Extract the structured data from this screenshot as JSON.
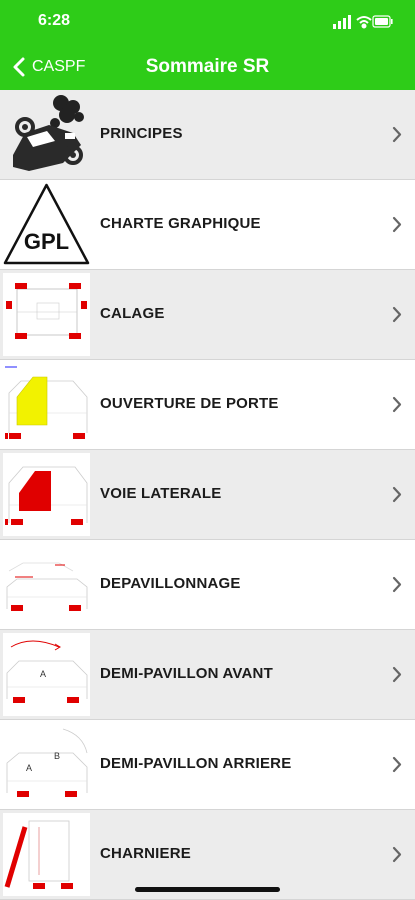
{
  "status": {
    "time": "6:28"
  },
  "nav": {
    "back_label": "CASPF",
    "title": "Sommaire SR"
  },
  "colors": {
    "accent": "#2ecc18",
    "marker": "#e00000",
    "highlight_yellow": "#f2f200"
  },
  "items": [
    {
      "label": "PRINCIPES",
      "icon": "car-crash-icon"
    },
    {
      "label": "CHARTE GRAPHIQUE",
      "icon": "gpl-warning-icon",
      "thumb_text": "GPL"
    },
    {
      "label": "CALAGE",
      "icon": "calage-diagram-icon"
    },
    {
      "label": "OUVERTURE DE PORTE",
      "icon": "door-opening-diagram-icon"
    },
    {
      "label": "VOIE LATERALE",
      "icon": "side-way-diagram-icon"
    },
    {
      "label": "DEPAVILLONNAGE",
      "icon": "roof-removal-diagram-icon"
    },
    {
      "label": "DEMI-PAVILLON AVANT",
      "icon": "front-half-roof-diagram-icon",
      "thumb_text": "A"
    },
    {
      "label": "DEMI-PAVILLON ARRIERE",
      "icon": "rear-half-roof-diagram-icon",
      "thumb_text": "A",
      "thumb_text_2": "B"
    },
    {
      "label": "CHARNIERE",
      "icon": "hinge-diagram-icon"
    }
  ]
}
